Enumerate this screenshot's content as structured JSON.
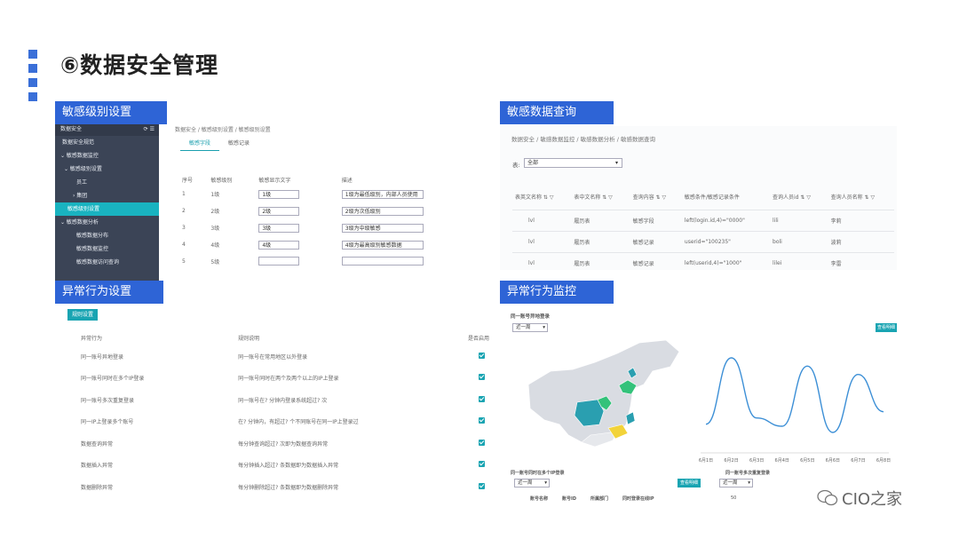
{
  "title": "⑥数据安全管理",
  "watermark": "CIO之家",
  "p1": {
    "header": "敏感级别设置",
    "sidebar": {
      "head": "数据安全",
      "items": [
        "数据安全规范",
        "⌄ 敏感数据监控",
        "⌄ 敏感级别设置",
        "员工",
        "› 集团",
        "敏感级别设置",
        "⌄ 敏感数据分析",
        "敏感数据分布",
        "敏感数据监控",
        "敏感数据访问查询"
      ]
    },
    "breadcrumb": "数据安全 / 敏感级别设置 / 敏感级别设置",
    "tabs": [
      "敏感字段",
      "敏感记录"
    ],
    "columns": [
      "序号",
      "敏感级别",
      "敏感显示文字",
      "描述"
    ],
    "rows": [
      {
        "n": "1",
        "lvl": "1级",
        "txt": "1级",
        "desc": "1级为最低级别，内部人员使用"
      },
      {
        "n": "2",
        "lvl": "2级",
        "txt": "2级",
        "desc": "2级为次低级别"
      },
      {
        "n": "3",
        "lvl": "3级",
        "txt": "3级",
        "desc": "3级为中级敏感"
      },
      {
        "n": "4",
        "lvl": "4级",
        "txt": "4级",
        "desc": "4级为最高级别敏感数据"
      },
      {
        "n": "5",
        "lvl": "5级",
        "txt": "",
        "desc": ""
      }
    ]
  },
  "p2": {
    "header": "敏感数据查询",
    "breadcrumb": "数据安全 / 敏感数据监控 / 敏感数据分析 / 敏感数据查询",
    "filter_label": "表:",
    "filter_value": "全部",
    "columns": [
      "表英文名称 ⇅ ▽",
      "表中文名称 ⇅ ▽",
      "查询内容 ⇅ ▽",
      "敏感条件/敏感记录条件",
      "查询人员id ⇅ ▽",
      "查询人员名称 ⇅ ▽"
    ],
    "rows": [
      [
        "lvl",
        "履历表",
        "敏感字段",
        "left(login.id,4)=\"0000\"",
        "lili",
        "李莉"
      ],
      [
        "lvl",
        "履历表",
        "敏感记录",
        "userid=\"100235\"",
        "boli",
        "波莉"
      ],
      [
        "lvl",
        "履历表",
        "敏感记录",
        "left(userid,4)=\"1000\"",
        "lilei",
        "李雷"
      ]
    ]
  },
  "p3": {
    "header": "异常行为设置",
    "button": "规则设置",
    "columns": [
      "异常行为",
      "规则说明",
      "是否启用"
    ],
    "rows": [
      [
        "同一账号异地登录",
        "同一账号在常用地区以外登录"
      ],
      [
        "同一账号同时在多个IP登录",
        "同一账号同时在两个及两个以上的IP上登录"
      ],
      [
        "同一账号多次重复登录",
        "同一账号在? 分钟内登录系统超过? 次"
      ],
      [
        "同一IP上登录多个账号",
        "在? 分钟内，有超过? 个不同账号在同一IP上登录过"
      ],
      [
        "数据查询异常",
        "每分钟查询超过? 次即为数据查询异常"
      ],
      [
        "数据插入异常",
        "每分钟插入超过? 条数据即为数据插入异常"
      ],
      [
        "数据删除异常",
        "每分钟删除超过? 条数据即为数据删除异常"
      ]
    ]
  },
  "p4": {
    "header": "异常行为监控",
    "section1": "同一账号异地登录",
    "select1": "近一周",
    "btn1": "查看明细",
    "section2": "同一账号同时在多个IP登录",
    "select2": "近一周",
    "btn2": "查看明细",
    "section3": "同一账号多次重复登录",
    "select3": "近一周",
    "table_cols": [
      "账号名称",
      "账号ID",
      "所属部门",
      "同时登录在线IP"
    ],
    "tick50": "50",
    "line_chart": {
      "x": [
        "6月1日",
        "6月2日",
        "6月3日",
        "6月4日",
        "6月5日",
        "6月6日",
        "6月7日",
        "6月8日"
      ],
      "values": [
        1.0,
        4.2,
        1.3,
        0.9,
        3.8,
        0.6,
        3.4,
        1.6
      ]
    },
    "colors": {
      "map_base": "#d9dce2",
      "teal": "#2a9fb0",
      "green": "#33c27a",
      "yellow": "#f2d33a"
    }
  }
}
